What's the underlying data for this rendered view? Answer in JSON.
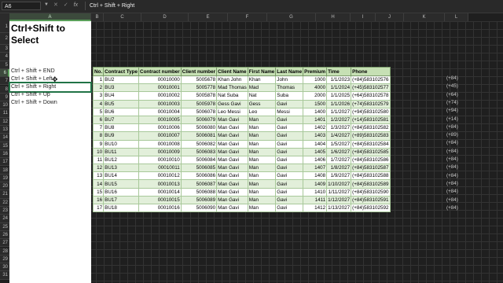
{
  "formula_bar": {
    "name_box": "A6",
    "formula": "Ctrl + Shift + Right",
    "fx": "fx",
    "cancel": "✕",
    "enter": "✓"
  },
  "columns": [
    "A",
    "B",
    "C",
    "D",
    "E",
    "F",
    "G",
    "H",
    "I",
    "J",
    "K",
    "L"
  ],
  "rows": [
    "1",
    "2",
    "3",
    "4",
    "5",
    "6",
    "7",
    "8",
    "9",
    "10",
    "11",
    "12",
    "13",
    "14",
    "15",
    "16",
    "17",
    "18",
    "19",
    "20",
    "21",
    "22",
    "23",
    "24",
    "25",
    "26",
    "27",
    "28",
    "29",
    "30",
    "31"
  ],
  "sheet": {
    "title_line1": "Ctrl+Shift to",
    "title_line2": "Select",
    "shortcuts": [
      "Ctrl + Shift + END",
      "Ctrl + Shift + Left",
      "Ctrl + Shift + Right",
      "Ctrl + Shift + Up",
      "Ctrl + Shift + Down"
    ]
  },
  "table": {
    "headers": [
      "No.",
      "Contract Type",
      "Contract number",
      "Client number",
      "Client Name",
      "First Name",
      "Last Name",
      "Premium",
      "Time",
      "Phone"
    ],
    "rows": [
      [
        "1",
        "BU2",
        "00010000",
        "5005678",
        "Khan John",
        "Khan",
        "John",
        "1000",
        "1/1/2023",
        "(+84)583102576",
        "(+84)"
      ],
      [
        "2",
        "BU3",
        "00010001",
        "5005778",
        "Mad Thomas",
        "Mad",
        "Thomas",
        "4000",
        "1/1/2024",
        "(+45)583102577",
        "(+45)"
      ],
      [
        "3",
        "BU4",
        "00010002",
        "5005878",
        "Nat Suba",
        "Nat",
        "Suba",
        "2000",
        "1/1/2025",
        "(+64)583102578",
        "(+64)"
      ],
      [
        "4",
        "BU5",
        "00010003",
        "5005978",
        "Gess Gavi",
        "Gess",
        "Gavi",
        "1500",
        "1/1/2026",
        "(+74)583102579",
        "(+74)"
      ],
      [
        "5",
        "BU6",
        "00010004",
        "5006078",
        "Leo Messi",
        "Leo",
        "Messi",
        "1400",
        "1/1/2027",
        "(+94)583102580",
        "(+94)"
      ],
      [
        "6",
        "BU7",
        "00010005",
        "5006079",
        "Man Gavi",
        "Man",
        "Gavi",
        "1401",
        "1/2/2027",
        "(+14)583102581",
        "(+14)"
      ],
      [
        "7",
        "BU8",
        "00010006",
        "5006080",
        "Man Gavi",
        "Man",
        "Gavi",
        "1402",
        "1/3/2027",
        "(+84)583102582",
        "(+84)"
      ],
      [
        "8",
        "BU9",
        "00010007",
        "5006081",
        "Man Gavi",
        "Man",
        "Gavi",
        "1403",
        "1/4/2027",
        "(+89)583102583",
        "(+89)"
      ],
      [
        "9",
        "BU10",
        "00010008",
        "5006082",
        "Man Gavi",
        "Man",
        "Gavi",
        "1404",
        "1/5/2027",
        "(+84)583102584",
        "(+84)"
      ],
      [
        "10",
        "BU11",
        "00010009",
        "5006083",
        "Man Gavi",
        "Man",
        "Gavi",
        "1405",
        "1/6/2027",
        "(+84)583102585",
        "(+84)"
      ],
      [
        "11",
        "BU12",
        "00010010",
        "5006084",
        "Man Gavi",
        "Man",
        "Gavi",
        "1406",
        "1/7/2027",
        "(+84)583102586",
        "(+84)"
      ],
      [
        "12",
        "BU13",
        "00010011",
        "5006085",
        "Man Gavi",
        "Man",
        "Gavi",
        "1407",
        "1/8/2027",
        "(+84)583102587",
        "(+84)"
      ],
      [
        "13",
        "BU14",
        "00010012",
        "5006086",
        "Man Gavi",
        "Man",
        "Gavi",
        "1408",
        "1/9/2027",
        "(+84)583102588",
        "(+84)"
      ],
      [
        "14",
        "BU15",
        "00010013",
        "5006087",
        "Man Gavi",
        "Man",
        "Gavi",
        "1409",
        "1/10/2027",
        "(+84)583102589",
        "(+84)"
      ],
      [
        "15",
        "BU16",
        "00010014",
        "5006088",
        "Man Gavi",
        "Man",
        "Gavi",
        "1410",
        "1/11/2027",
        "(+84)583102590",
        "(+84)"
      ],
      [
        "16",
        "BU17",
        "00010015",
        "5006089",
        "Man Gavi",
        "Man",
        "Gavi",
        "1411",
        "1/12/2027",
        "(+84)583102591",
        "(+84)"
      ],
      [
        "17",
        "BU18",
        "00010016",
        "5006090",
        "Man Gavi",
        "Man",
        "Gavi",
        "1412",
        "1/13/2027",
        "(+84)583102592",
        "(+84)"
      ]
    ]
  },
  "colors": {
    "header_fill": "#c6e0b4",
    "band_fill": "#e2efda",
    "selection": "#217346"
  }
}
